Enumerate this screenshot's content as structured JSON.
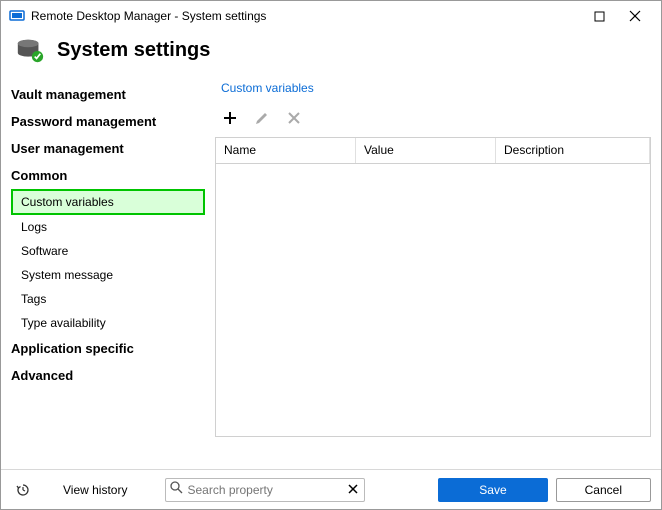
{
  "window": {
    "title": "Remote Desktop Manager - System settings"
  },
  "header": {
    "title": "System settings"
  },
  "sidebar": {
    "sections": [
      {
        "label": "Vault management",
        "items": []
      },
      {
        "label": "Password management",
        "items": []
      },
      {
        "label": "User management",
        "items": []
      },
      {
        "label": "Common",
        "items": [
          {
            "label": "Custom variables",
            "selected": true
          },
          {
            "label": "Logs"
          },
          {
            "label": "Software"
          },
          {
            "label": "System message"
          },
          {
            "label": "Tags"
          },
          {
            "label": "Type availability"
          }
        ]
      },
      {
        "label": "Application specific",
        "items": []
      },
      {
        "label": "Advanced",
        "items": []
      }
    ]
  },
  "main": {
    "breadcrumb": "Custom variables",
    "columns": {
      "name": "Name",
      "value": "Value",
      "desc": "Description"
    }
  },
  "footer": {
    "view_history": "View history",
    "search_placeholder": "Search property",
    "save": "Save",
    "cancel": "Cancel"
  }
}
